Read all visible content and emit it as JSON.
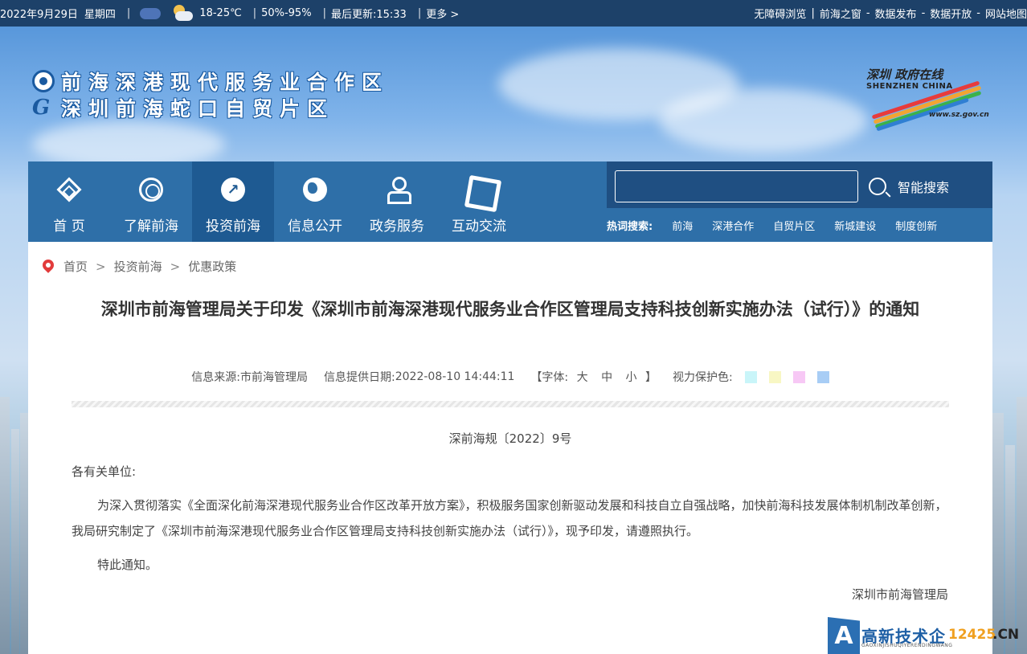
{
  "topbar": {
    "date": "2022年9月29日",
    "weekday": "星期四",
    "temp": "18-25℃",
    "humidity": "50%-95%",
    "updated": "最后更新:15:33",
    "more": "更多 >",
    "sep": "|",
    "links": [
      "无障碍浏览",
      "前海之窗",
      "数据发布",
      "数据开放",
      "网站地图"
    ],
    "link_seps": [
      "|",
      "-",
      "-",
      "-"
    ]
  },
  "header": {
    "logo_line1": "前海深港现代服务业合作区",
    "logo_line2": "深圳前海蛇口自贸片区",
    "logo2_g": "G",
    "sz_logo_text": "深圳 政府在线",
    "sz_logo_en": "SHENZHEN CHINA",
    "sz_logo_url": "www.sz.gov.cn"
  },
  "nav": [
    {
      "label": "首 页"
    },
    {
      "label": "了解前海"
    },
    {
      "label": "投资前海"
    },
    {
      "label": "信息公开"
    },
    {
      "label": "政务服务"
    },
    {
      "label": "互动交流"
    }
  ],
  "search": {
    "placeholder": "",
    "button_label": "智能搜索",
    "hot_label": "热词搜索:",
    "hot_words": [
      "前海",
      "深港合作",
      "自贸片区",
      "新城建设",
      "制度创新"
    ]
  },
  "breadcrumb": {
    "items": [
      "首页",
      "投资前海",
      "优惠政策"
    ],
    "sep": ">"
  },
  "article": {
    "title": "深圳市前海管理局关于印发《深圳市前海深港现代服务业合作区管理局支持科技创新实施办法（试行）》的通知",
    "source_label": "信息来源:",
    "source": "市前海管理局",
    "date_label": "信息提供日期:",
    "date": "2022-08-10 14:44:11",
    "font_label": "【字体:",
    "font_sizes": [
      "大",
      "中",
      "小"
    ],
    "font_close": "】",
    "eye_label": "视力保护色:",
    "eye_colors": [
      "#c9f5f9",
      "#f8f7c4",
      "#f7c8f5",
      "#a8cdf5"
    ],
    "doc_no": "深前海规〔2022〕9号",
    "greeting": "各有关单位:",
    "body": "为深入贯彻落实《全面深化前海深港现代服务业合作区改革开放方案》，积极服务国家创新驱动发展和科技自立自强战略，加快前海科技发展体制机制改革创新，我局研究制定了《深圳市前海深港现代服务业合作区管理局支持科技创新实施办法（试行）》，现予印发，请遵照执行。",
    "closing": "特此通知。",
    "signature": "深圳市前海管理局"
  },
  "watermark": {
    "letter": "A",
    "main": "高新技术企",
    "sub": "GAOXINJISHUQIYERENDINGWANG",
    "num": "12425",
    "cn": ".CN"
  }
}
